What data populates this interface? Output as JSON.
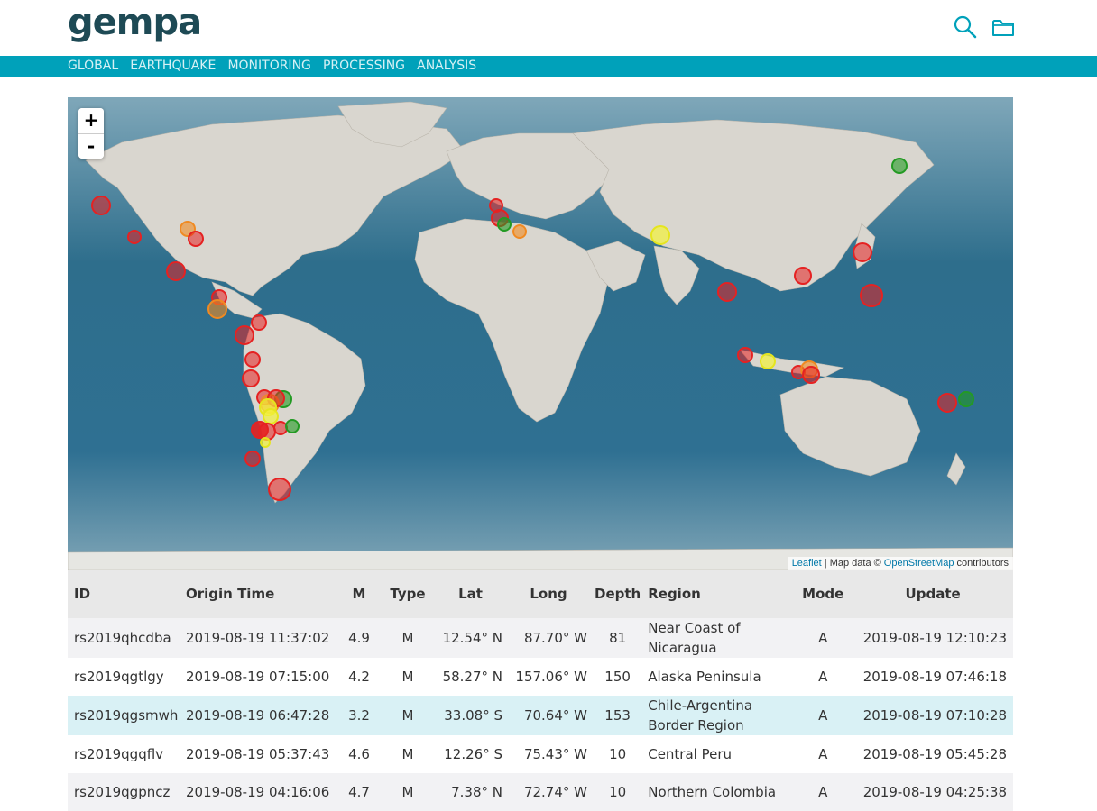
{
  "header": {
    "logo_text": "gempa",
    "search_icon": "search-icon",
    "folder_icon": "folder-icon"
  },
  "nav": {
    "items": [
      "GLOBAL",
      "EARTHQUAKE",
      "MONITORING",
      "PROCESSING",
      "ANALYSIS"
    ]
  },
  "map": {
    "zoom_in": "+",
    "zoom_out": "-",
    "attribution": {
      "leaflet": "Leaflet",
      "map_data": "| Map data ©",
      "osm": "OpenStreetMap",
      "contributors": "contributors"
    },
    "legend_colors": {
      "red": "#e52222",
      "orange": "#f08a22",
      "yellow": "#f2f23a",
      "green": "#239a23"
    }
  },
  "table": {
    "headers": {
      "id": "ID",
      "origin_time": "Origin Time",
      "m": "M",
      "type": "Type",
      "lat": "Lat",
      "long": "Long",
      "depth": "Depth",
      "region": "Region",
      "mode": "Mode",
      "update": "Update"
    },
    "rows": [
      {
        "id": "rs2019qhcdba",
        "time": "2019-08-19 11:37:02",
        "m": "4.9",
        "type": "M",
        "lat": "12.54° N",
        "lon": "87.70° W",
        "depth": "81",
        "region": "Near Coast of Nicaragua",
        "mode": "A",
        "update": "2019-08-19 12:10:23"
      },
      {
        "id": "rs2019qgtlgy",
        "time": "2019-08-19 07:15:00",
        "m": "4.2",
        "type": "M",
        "lat": "58.27° N",
        "lon": "157.06° W",
        "depth": "150",
        "region": "Alaska Peninsula",
        "mode": "A",
        "update": "2019-08-19 07:46:18"
      },
      {
        "id": "rs2019qgsmwh",
        "time": "2019-08-19 06:47:28",
        "m": "3.2",
        "type": "M",
        "lat": "33.08° S",
        "lon": "70.64° W",
        "depth": "153",
        "region": "Chile-Argentina Border Region",
        "mode": "A",
        "update": "2019-08-19 07:10:28"
      },
      {
        "id": "rs2019qgqflv",
        "time": "2019-08-19 05:37:43",
        "m": "4.6",
        "type": "M",
        "lat": "12.26° S",
        "lon": "75.43° W",
        "depth": "10",
        "region": "Central Peru",
        "mode": "A",
        "update": "2019-08-19 05:45:28"
      },
      {
        "id": "rs2019qgpncz",
        "time": "2019-08-19 04:16:06",
        "m": "4.7",
        "type": "M",
        "lat": "7.38° N",
        "lon": "72.74° W",
        "depth": "10",
        "region": "Northern Colombia",
        "mode": "A",
        "update": "2019-08-19 04:25:38"
      }
    ]
  }
}
